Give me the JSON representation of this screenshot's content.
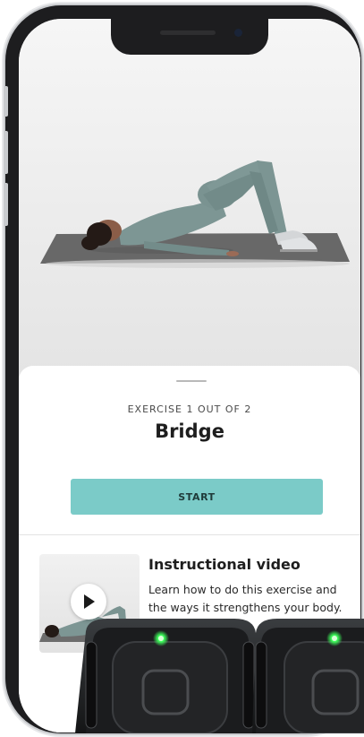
{
  "exercise": {
    "counter": "EXERCISE  1 OUT OF 2",
    "name": "Bridge",
    "start_label": "START"
  },
  "video": {
    "title": "Instructional video",
    "description": "Learn how to do this exercise and the ways it strengthens your body."
  },
  "colors": {
    "accent": "#7bcbc8",
    "sensor_led": "#3cff5a",
    "mat": "#676767",
    "outfit": "#7c9593"
  },
  "icons": {
    "play": "play-icon",
    "led": "sensor-led"
  }
}
